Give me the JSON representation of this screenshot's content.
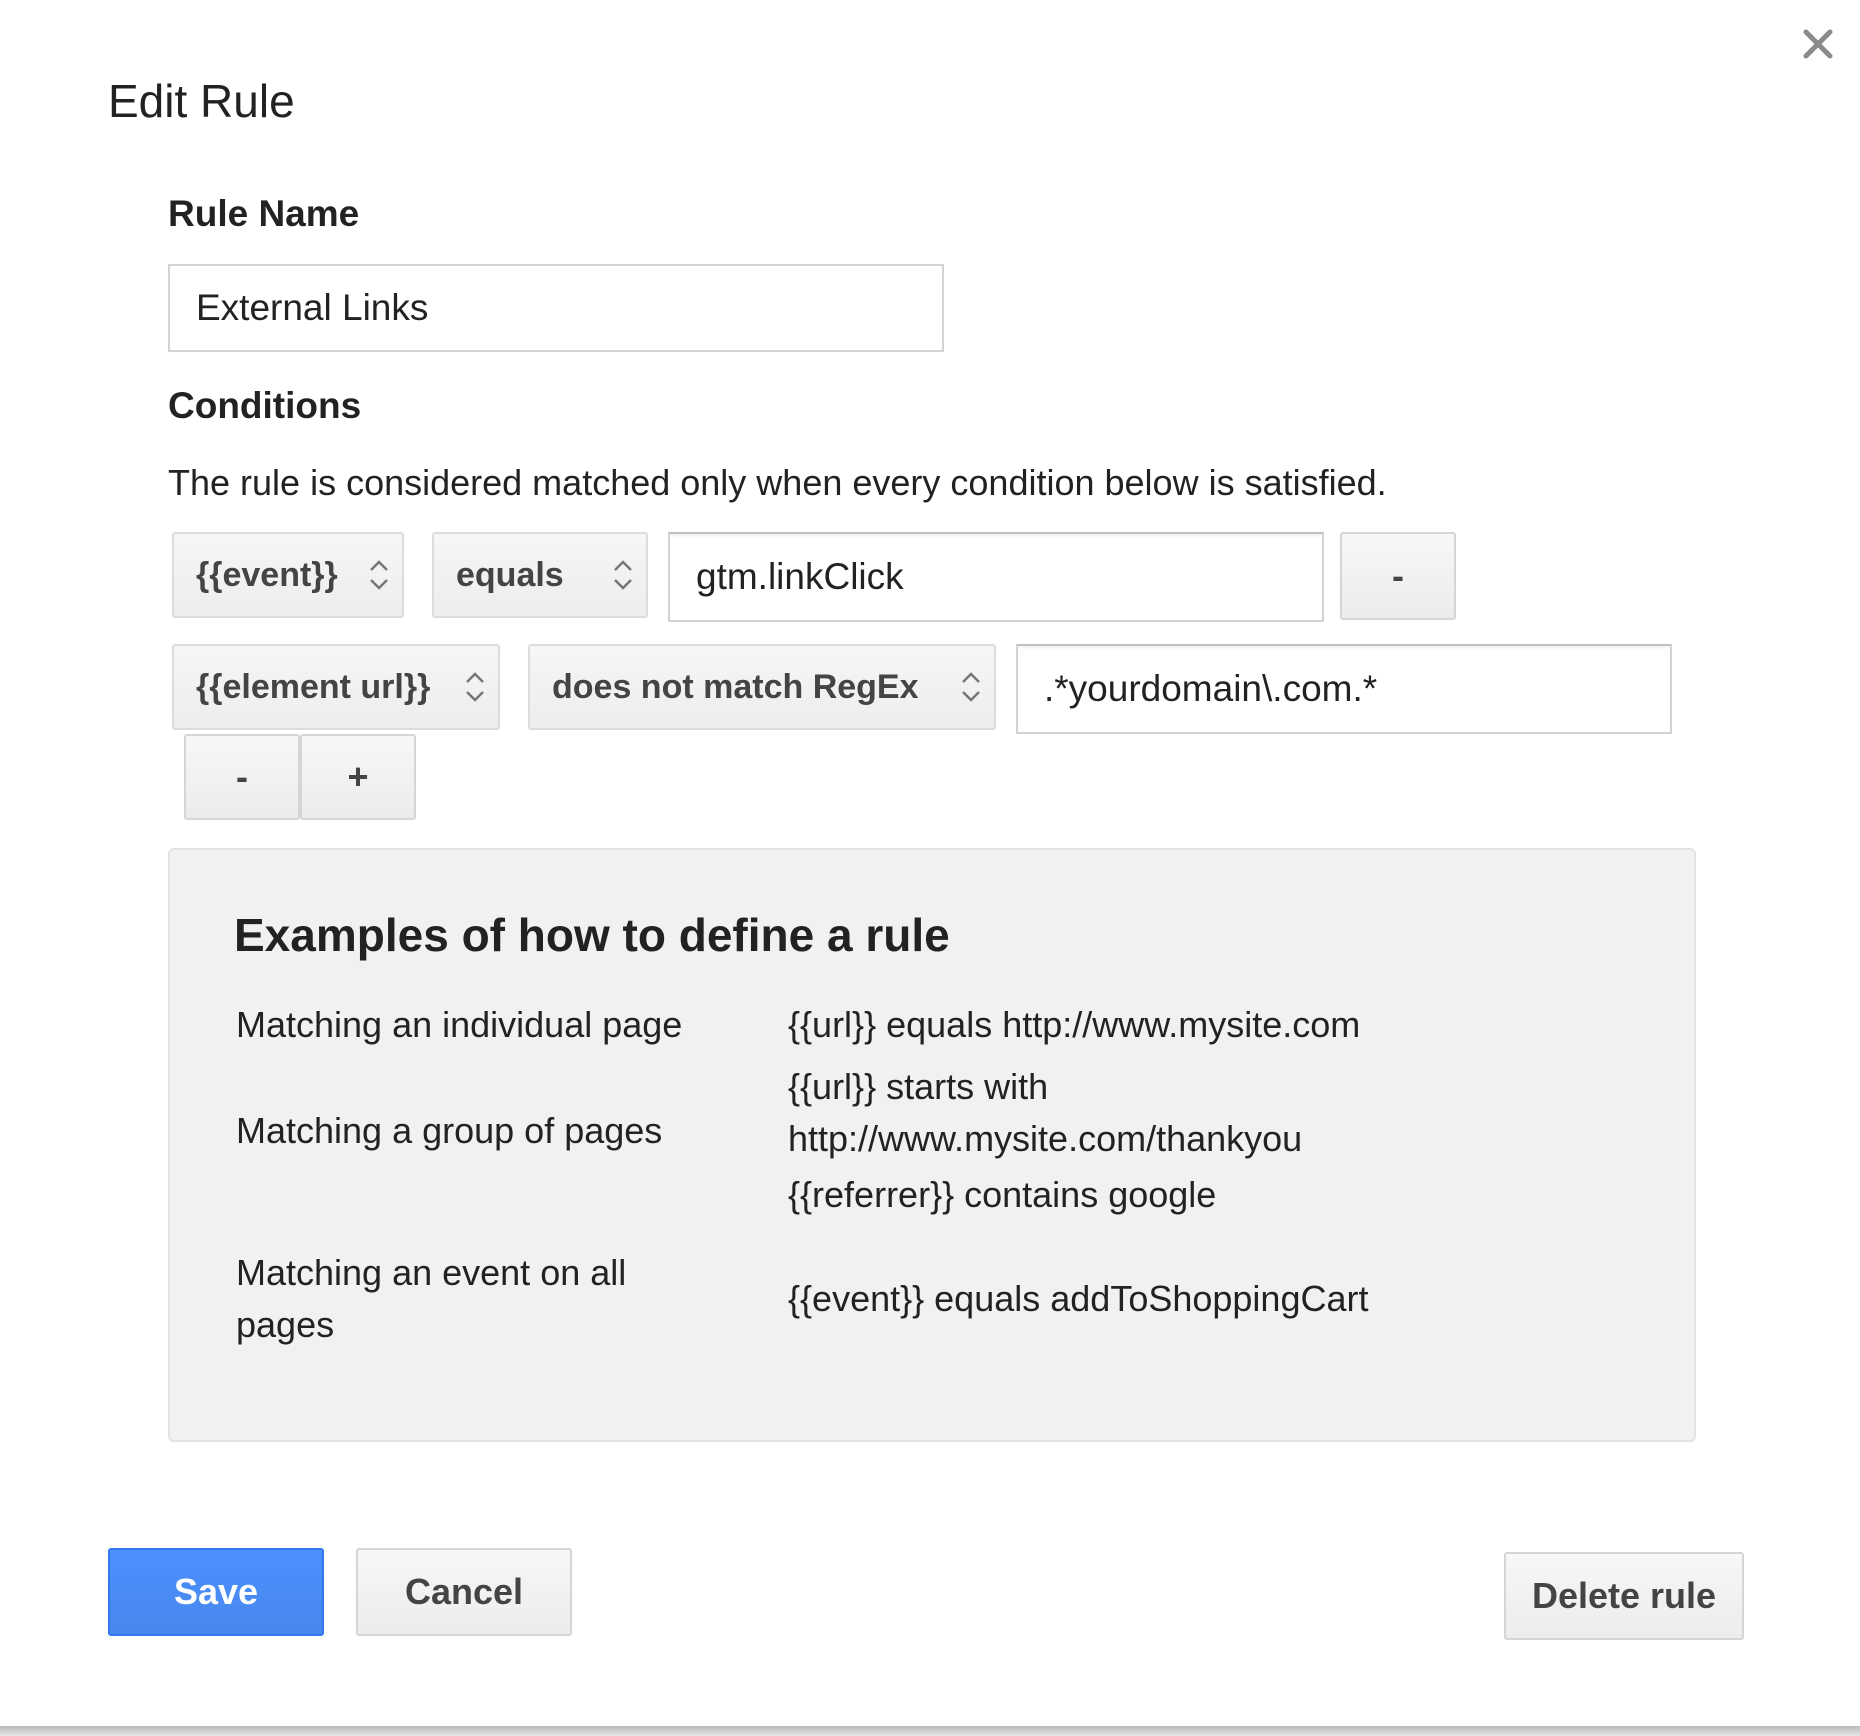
{
  "dialog": {
    "title": "Edit Rule"
  },
  "rule_name": {
    "label": "Rule Name",
    "value": "External Links"
  },
  "conditions": {
    "label": "Conditions",
    "description": "The rule is considered matched only when every condition below is satisfied.",
    "rows": [
      {
        "variable": "{{event}}",
        "operator": "equals",
        "value": "gtm.linkClick",
        "remove_label": "-"
      },
      {
        "variable": "{{element url}}",
        "operator": "does not match RegEx",
        "value": ".*yourdomain\\.com.*",
        "remove_label": "-",
        "add_label": "+"
      }
    ]
  },
  "examples": {
    "title": "Examples of how to define a rule",
    "items": [
      {
        "label": "Matching an individual page",
        "value_lines": [
          "{{url}} equals http://www.mysite.com"
        ]
      },
      {
        "label": "Matching a group of pages",
        "value_lines": [
          "{{url}} starts with",
          "http://www.mysite.com/thankyou",
          "{{referrer}} contains google"
        ]
      },
      {
        "label_lines": [
          "Matching an event on all",
          "pages"
        ],
        "value_lines": [
          "{{event}} equals addToShoppingCart"
        ]
      }
    ]
  },
  "footer": {
    "save_label": "Save",
    "cancel_label": "Cancel",
    "delete_label": "Delete rule"
  },
  "colors": {
    "primary": "#4d90fe",
    "panel_bg": "#f1f1f1",
    "text": "#222222"
  }
}
